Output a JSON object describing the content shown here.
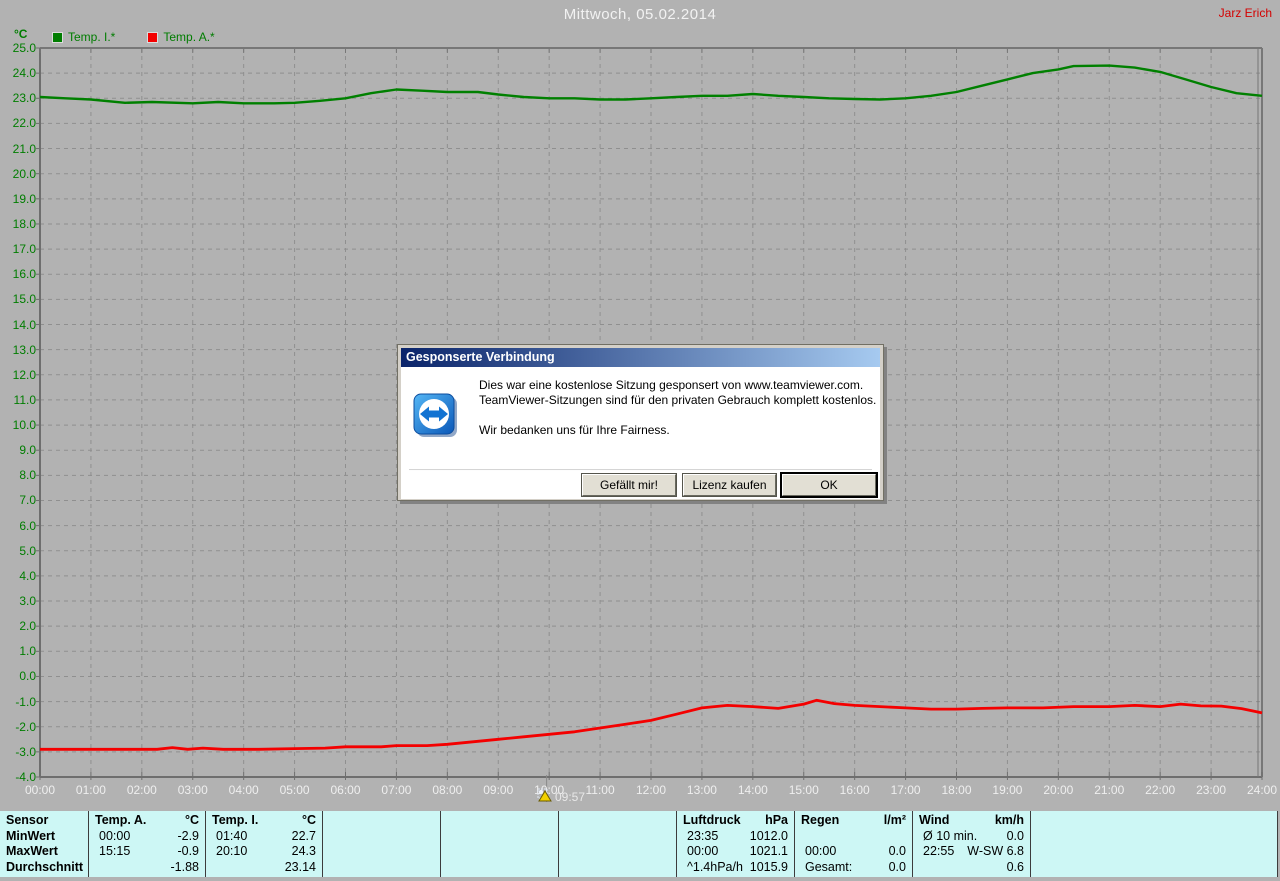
{
  "header": {
    "title": "Mittwoch, 05.02.2014",
    "user": "Jarz Erich"
  },
  "chart_data": {
    "type": "line",
    "title": "Mittwoch, 05.02.2014",
    "ylabel": "°C",
    "ylim": [
      -4.0,
      25.0
    ],
    "xlim": [
      0,
      24
    ],
    "y_tick_step": 1.0,
    "x_tick_step_hours": 1,
    "grid": "dashed",
    "legend_position": "top-left",
    "legend": [
      {
        "label": "Temp. I.*",
        "color": "#007d00"
      },
      {
        "label": "Temp. A.*",
        "color": "#f40000"
      }
    ],
    "series": [
      {
        "name": "Temp. I.",
        "color": "#008000",
        "width": 2.4,
        "points": [
          [
            0,
            23.05
          ],
          [
            0.5,
            23.0
          ],
          [
            1,
            22.95
          ],
          [
            1.67,
            22.82
          ],
          [
            2.2,
            22.85
          ],
          [
            3,
            22.8
          ],
          [
            3.5,
            22.85
          ],
          [
            4,
            22.8
          ],
          [
            4.6,
            22.8
          ],
          [
            5,
            22.82
          ],
          [
            5.5,
            22.9
          ],
          [
            6,
            23.0
          ],
          [
            6.5,
            23.2
          ],
          [
            7,
            23.35
          ],
          [
            7.5,
            23.3
          ],
          [
            8,
            23.25
          ],
          [
            8.6,
            23.25
          ],
          [
            9,
            23.15
          ],
          [
            9.5,
            23.05
          ],
          [
            10,
            23.0
          ],
          [
            10.5,
            23.0
          ],
          [
            11,
            22.95
          ],
          [
            11.5,
            22.95
          ],
          [
            12,
            23.0
          ],
          [
            12.5,
            23.05
          ],
          [
            13,
            23.1
          ],
          [
            13.5,
            23.1
          ],
          [
            14,
            23.17
          ],
          [
            14.5,
            23.1
          ],
          [
            15,
            23.05
          ],
          [
            15.5,
            23.0
          ],
          [
            16,
            22.97
          ],
          [
            16.5,
            22.95
          ],
          [
            17,
            23.0
          ],
          [
            17.5,
            23.1
          ],
          [
            18,
            23.25
          ],
          [
            18.5,
            23.5
          ],
          [
            19,
            23.75
          ],
          [
            19.5,
            24.0
          ],
          [
            20,
            24.15
          ],
          [
            20.3,
            24.28
          ],
          [
            21,
            24.3
          ],
          [
            21.5,
            24.22
          ],
          [
            22,
            24.05
          ],
          [
            22.5,
            23.75
          ],
          [
            23,
            23.45
          ],
          [
            23.5,
            23.2
          ],
          [
            24,
            23.1
          ]
        ]
      },
      {
        "name": "Temp. A.",
        "color": "#f40000",
        "width": 2.8,
        "points": [
          [
            0,
            -2.9
          ],
          [
            0.7,
            -2.9
          ],
          [
            1.5,
            -2.9
          ],
          [
            2.3,
            -2.9
          ],
          [
            2.6,
            -2.83
          ],
          [
            2.9,
            -2.9
          ],
          [
            3.2,
            -2.85
          ],
          [
            3.6,
            -2.9
          ],
          [
            4.3,
            -2.9
          ],
          [
            5,
            -2.87
          ],
          [
            5.6,
            -2.85
          ],
          [
            6,
            -2.8
          ],
          [
            6.7,
            -2.8
          ],
          [
            7,
            -2.75
          ],
          [
            7.6,
            -2.75
          ],
          [
            8,
            -2.7
          ],
          [
            8.5,
            -2.6
          ],
          [
            9,
            -2.5
          ],
          [
            9.5,
            -2.4
          ],
          [
            10,
            -2.3
          ],
          [
            10.5,
            -2.2
          ],
          [
            11,
            -2.05
          ],
          [
            11.5,
            -1.9
          ],
          [
            12,
            -1.75
          ],
          [
            12.5,
            -1.5
          ],
          [
            13,
            -1.25
          ],
          [
            13.5,
            -1.15
          ],
          [
            14,
            -1.2
          ],
          [
            14.5,
            -1.27
          ],
          [
            15,
            -1.1
          ],
          [
            15.25,
            -0.95
          ],
          [
            15.6,
            -1.08
          ],
          [
            16,
            -1.15
          ],
          [
            16.5,
            -1.2
          ],
          [
            17,
            -1.25
          ],
          [
            17.5,
            -1.3
          ],
          [
            18,
            -1.3
          ],
          [
            18.5,
            -1.27
          ],
          [
            19,
            -1.25
          ],
          [
            19.7,
            -1.25
          ],
          [
            20.3,
            -1.2
          ],
          [
            21,
            -1.2
          ],
          [
            21.5,
            -1.15
          ],
          [
            22,
            -1.2
          ],
          [
            22.4,
            -1.1
          ],
          [
            22.8,
            -1.17
          ],
          [
            23.2,
            -1.18
          ],
          [
            23.6,
            -1.28
          ],
          [
            24,
            -1.45
          ]
        ]
      }
    ],
    "cursor": {
      "hour": 9.95,
      "time_label": "09:57"
    }
  },
  "dialog": {
    "title": "Gesponserte Verbindung",
    "line1": "Dies war eine kostenlose Sitzung gesponsert von www.teamviewer.com.",
    "line2": "TeamViewer-Sitzungen sind für den privaten Gebrauch komplett kostenlos.",
    "line3": "Wir bedanken uns für Ihre Fairness.",
    "buttons": {
      "like": "Gefällt mir!",
      "buy": "Lizenz kaufen",
      "ok": "OK"
    }
  },
  "stats_table": {
    "row_labels": [
      "Sensor",
      "MinWert",
      "MaxWert",
      "Durchschnitt"
    ],
    "columns": [
      {
        "name": "Temp. A.",
        "unit": "°C",
        "rows": [
          [
            "00:00",
            "-2.9"
          ],
          [
            "15:15",
            "-0.9"
          ],
          [
            "",
            "-1.88"
          ]
        ]
      },
      {
        "name": "Temp. I.",
        "unit": "°C",
        "rows": [
          [
            "01:40",
            "22.7"
          ],
          [
            "20:10",
            "24.3"
          ],
          [
            "",
            "23.14"
          ]
        ]
      },
      {
        "name": "",
        "unit": "",
        "rows": [
          [
            "",
            ""
          ],
          [
            "",
            ""
          ],
          [
            "",
            ""
          ]
        ]
      },
      {
        "name": "",
        "unit": "",
        "rows": [
          [
            "",
            ""
          ],
          [
            "",
            ""
          ],
          [
            "",
            ""
          ]
        ]
      },
      {
        "name": "",
        "unit": "",
        "rows": [
          [
            "",
            ""
          ],
          [
            "",
            ""
          ],
          [
            "",
            ""
          ]
        ]
      },
      {
        "name": "Luftdruck",
        "unit": "hPa",
        "rows": [
          [
            "23:35",
            "1012.0"
          ],
          [
            "00:00",
            "1021.1"
          ],
          [
            "^1.4hPa/h",
            "1015.9"
          ]
        ]
      },
      {
        "name": "Regen",
        "unit": "l/m²",
        "rows": [
          [
            "",
            ""
          ],
          [
            "00:00",
            "0.0"
          ],
          [
            "Gesamt:",
            "0.0"
          ]
        ]
      },
      {
        "name": "Wind",
        "unit": "km/h",
        "rows": [
          [
            "Ø 10 min.",
            "0.0"
          ],
          [
            "22:55",
            "W-SW 6.8"
          ],
          [
            "",
            "0.6"
          ]
        ]
      }
    ]
  },
  "colors": {
    "background": "#b2b2b2",
    "plot_frame": "#777777",
    "gridline": "#8f8f8f",
    "axis_text_x": "#efefef",
    "axis_text_y": "#007d00",
    "table_background": "#cdf7f5",
    "titlebar_left": "#0a246a",
    "titlebar_right": "#a6caf0"
  }
}
